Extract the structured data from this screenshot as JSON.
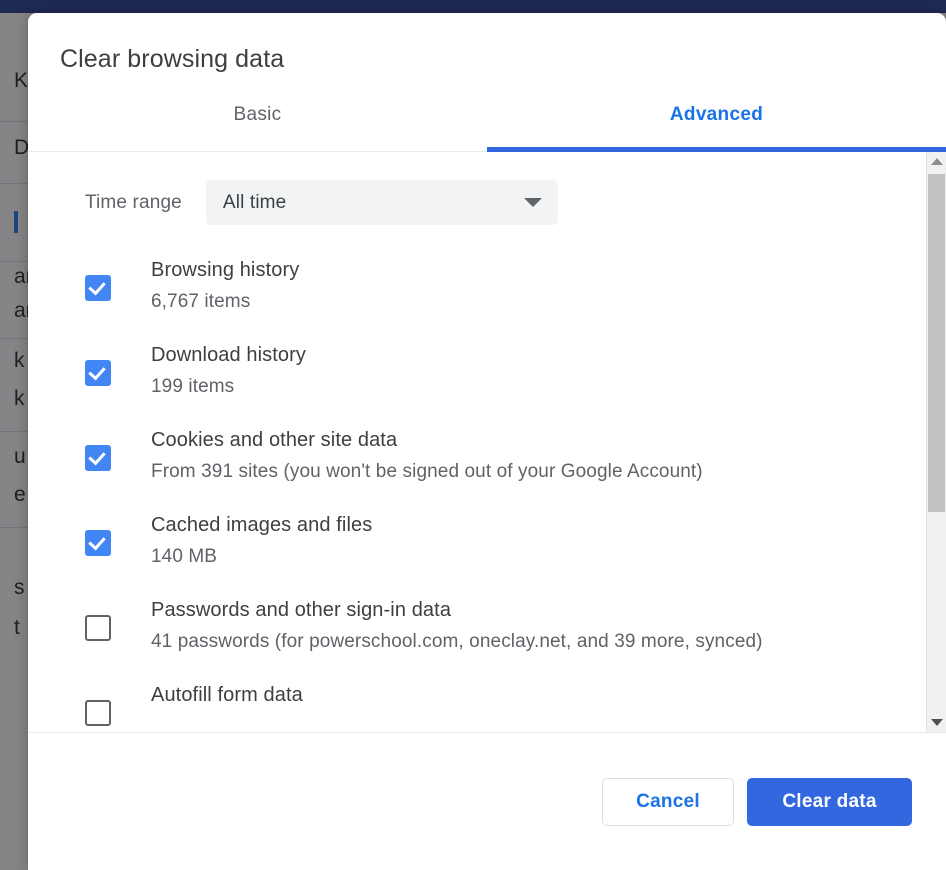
{
  "dialog": {
    "title": "Clear browsing data",
    "tabs": [
      {
        "label": "Basic",
        "active": false
      },
      {
        "label": "Advanced",
        "active": true
      }
    ],
    "time_range": {
      "label": "Time range",
      "value": "All time",
      "caret_icon": "chevron-down-icon"
    },
    "items": [
      {
        "title": "Browsing history",
        "subtitle": "6,767 items",
        "checked": true
      },
      {
        "title": "Download history",
        "subtitle": "199 items",
        "checked": true
      },
      {
        "title": "Cookies and other site data",
        "subtitle": "From 391 sites (you won't be signed out of your Google Account)",
        "checked": true
      },
      {
        "title": "Cached images and files",
        "subtitle": "140 MB",
        "checked": true
      },
      {
        "title": "Passwords and other sign-in data",
        "subtitle": "41 passwords (for powerschool.com, oneclay.net, and 39 more, synced)",
        "checked": false
      },
      {
        "title": "Autofill form data",
        "subtitle": "",
        "checked": false
      }
    ],
    "footer": {
      "cancel_label": "Cancel",
      "clear_label": "Clear data"
    },
    "scrollbar": {
      "up_icon": "triangle-up-icon",
      "down_icon": "triangle-down-icon"
    }
  },
  "background": {
    "fragments": [
      "K",
      "D",
      "ar",
      "ar",
      "k",
      "k",
      "u",
      "e",
      "s",
      "t"
    ]
  },
  "colors": {
    "accent_blue": "#1a73e8",
    "tab_indicator": "#3367e0",
    "checkbox_blue": "#4285f4",
    "primary_button": "#3367e0",
    "title_text": "#3c4043",
    "secondary_text": "#5f6368",
    "browser_band": "#1f2a52",
    "scrim": "rgba(32,33,36,0.55)",
    "scrollbar_thumb": "#c1c1c1"
  }
}
